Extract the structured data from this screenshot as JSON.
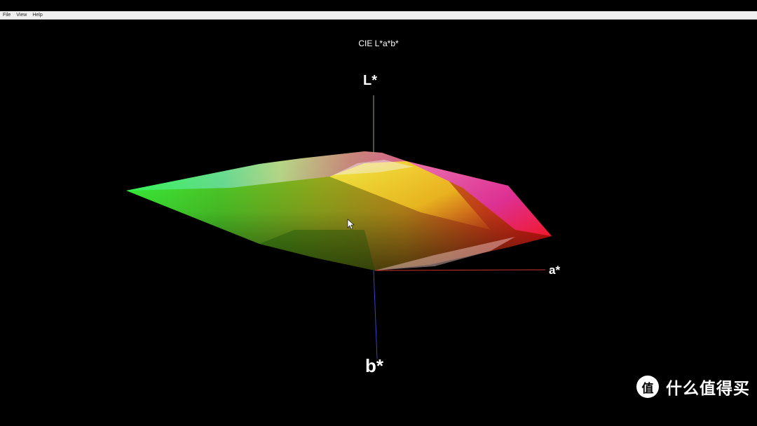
{
  "menu": {
    "items": [
      {
        "label": "File"
      },
      {
        "label": "View"
      },
      {
        "label": "Help"
      }
    ]
  },
  "plot": {
    "title": "CIE L*a*b*",
    "axes": {
      "l_label": "L*",
      "a_label": "a*",
      "b_label": "b*"
    },
    "axis_colors": {
      "l": "#9aaa7a",
      "a": "#cc3333",
      "b": "#3344cc"
    }
  },
  "gamut_colors": [
    "#32ff32",
    "#7ae8e8",
    "#f0f020",
    "#e23ee0",
    "#ff1c1c",
    "#1a6a0a"
  ],
  "watermark": {
    "icon_glyph": "值",
    "text": "什么值得买"
  }
}
